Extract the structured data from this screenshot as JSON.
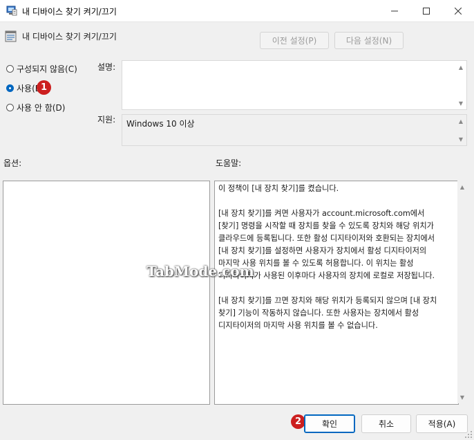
{
  "window": {
    "title": "내 디바이스 찾기 켜기/끄기",
    "icon": "policy-icon"
  },
  "header": {
    "title": "내 디바이스 찾기 켜기/끄기",
    "prev_label": "이전 설정(P)",
    "next_label": "다음 설정(N)"
  },
  "radios": [
    {
      "label": "구성되지 않음(C)",
      "selected": false
    },
    {
      "label": "사용(E)",
      "selected": true
    },
    {
      "label": "사용 안 함(D)",
      "selected": false
    }
  ],
  "labels": {
    "description": "설명:",
    "supported": "지원:",
    "options": "옵션:",
    "help": "도움말:"
  },
  "supported_value": "Windows 10 이상",
  "help_paragraphs": [
    "이 정책이 [내 장치 찾기]를 켰습니다.",
    "[내 장치 찾기]를 켜면 사용자가 account.microsoft.com에서 [찾기] 명령을 시작할 때 장치를 찾을 수 있도록 장치와 해당 위치가 클라우드에 등록됩니다. 또한 활성 디지타이저와 호환되는 장치에서 [내 장치 찾기]를 설정하면 사용자가 장치에서 활성 디지타이저의 마지막 사용 위치를 볼 수 있도록 허용합니다. 이 위치는 활성 디지타이저가 사용된 이후마다 사용자의 장치에 로컬로 저장됩니다.",
    "[내 장치 찾기]를 끄면 장치와 해당 위치가 등록되지 않으며 [내 장치 찾기] 기능이 작동하지 않습니다. 또한 사용자는 장치에서 활성 디지타이저의 마지막 사용 위치를 볼 수 없습니다."
  ],
  "annotations": {
    "step1": "1",
    "step2": "2"
  },
  "watermark": "TabMode.com",
  "buttons": {
    "ok": "확인",
    "cancel": "취소",
    "apply": "적용(A)"
  },
  "colors": {
    "accent": "#0067c0",
    "badge": "#cc1f1f"
  }
}
